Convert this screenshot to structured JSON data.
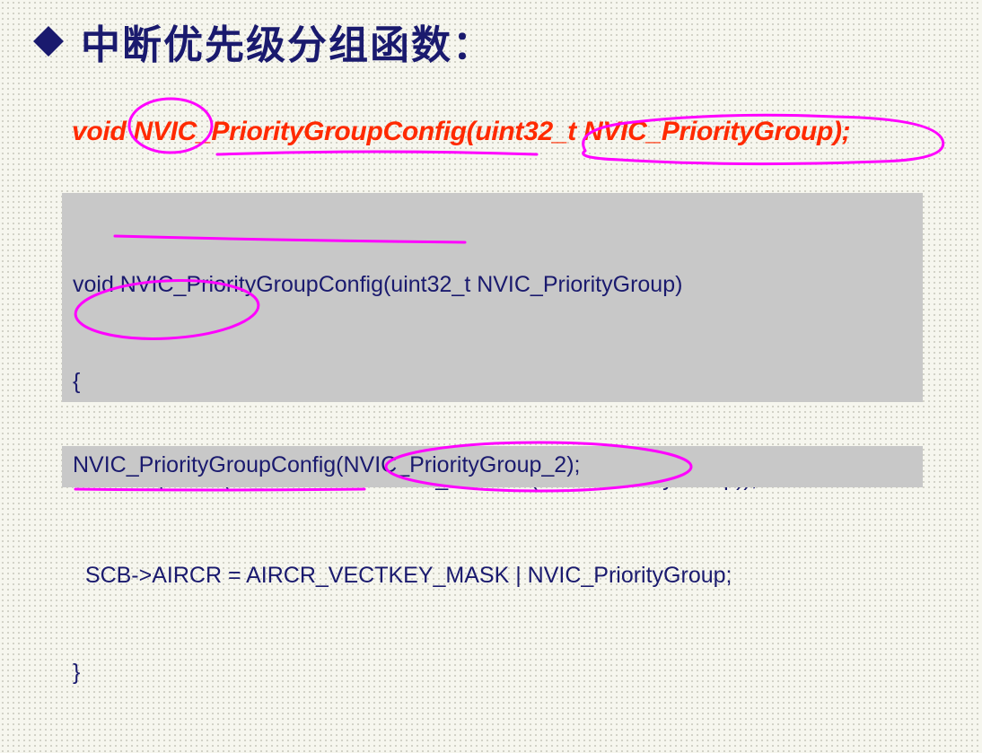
{
  "title": {
    "text": "中断优先级分组函数：",
    "bullet_icon": "diamond-bullet-icon"
  },
  "prototype": "void NVIC_PriorityGroupConfig(uint32_t NVIC_PriorityGroup);",
  "code_block": {
    "lines": [
      "void NVIC_PriorityGroupConfig(uint32_t NVIC_PriorityGroup)",
      "{",
      "  assert_param(IS_NVIC_PRIORITY_GROUP(NVIC_PriorityGroup));",
      "  SCB->AIRCR = AIRCR_VECTKEY_MASK | NVIC_PriorityGroup;",
      "}"
    ]
  },
  "call_example": "NVIC_PriorityGroupConfig(NVIC_PriorityGroup_2);",
  "colors": {
    "title": "#1a1a6e",
    "prototype": "#ff2a00",
    "code_text": "#1a1a6e",
    "code_bg": "#c8c8c8",
    "annotation": "#ff00ff"
  }
}
